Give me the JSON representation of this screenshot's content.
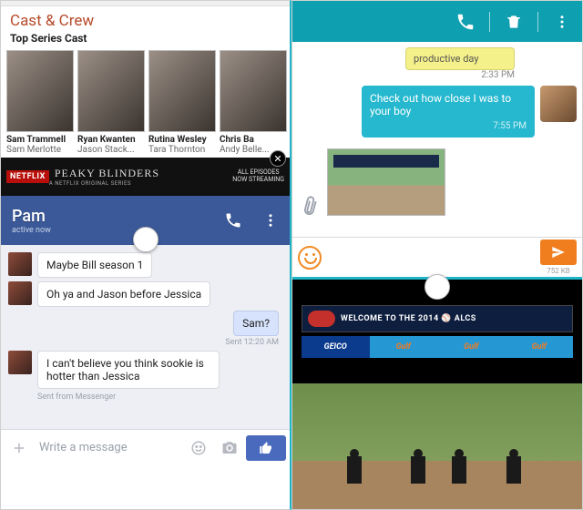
{
  "left": {
    "cast": {
      "heading": "Cast & Crew",
      "subheading": "Top Series Cast",
      "members": [
        {
          "name": "Sam Trammell",
          "role": "Sam Merlotte"
        },
        {
          "name": "Ryan Kwanten",
          "role": "Jason Stack..."
        },
        {
          "name": "Rutina Wesley",
          "role": "Tara Thornton"
        },
        {
          "name": "Chris Ba",
          "role": "Andy Belle..."
        }
      ]
    },
    "ad": {
      "brand": "NETFLIX",
      "title": "PEAKY BLINDERS",
      "subtitle": "A NETFLIX ORIGINAL SERIES",
      "cta_top": "ALL EPISODES",
      "cta_bottom": "NOW STREAMING"
    },
    "chat": {
      "contact": "Pam",
      "status": "active now",
      "messages": [
        {
          "dir": "in",
          "text": "Maybe Bill season 1"
        },
        {
          "dir": "in",
          "text": "Oh ya and Jason before Jessica"
        },
        {
          "dir": "out",
          "text": "Sam?",
          "meta": "Sent 12:20 AM"
        },
        {
          "dir": "in",
          "text": "I can't believe you think sookie is hotter than Jessica",
          "meta": "Sent from Messenger"
        }
      ],
      "composer_placeholder": "Write a message"
    }
  },
  "right": {
    "sms": {
      "prev_fragment": "productive day",
      "prev_time": "2:33 PM",
      "out_text": "Check out how close I was to your boy",
      "out_time": "7:55 PM",
      "attachment_size": "752 KB"
    },
    "video": {
      "scoreboard_text": "WELCOME TO THE 2014 ⚾ ALCS",
      "ads": [
        "GEICO",
        "Gulf",
        "Gulf",
        "Gulf"
      ]
    }
  }
}
